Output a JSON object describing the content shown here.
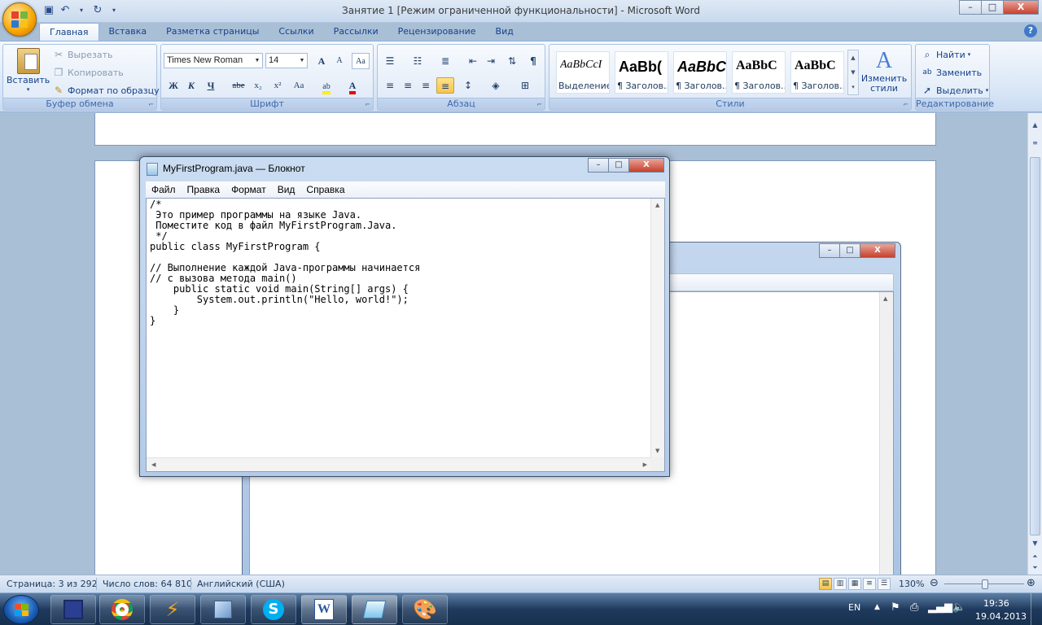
{
  "window": {
    "title": "Занятие 1 [Режим ограниченной функциональности]  -  Microsoft Word",
    "minimize": "–",
    "maximize": "□",
    "close": "X"
  },
  "ribbon_tabs": [
    "Главная",
    "Вставка",
    "Разметка страницы",
    "Ссылки",
    "Рассылки",
    "Рецензирование",
    "Вид"
  ],
  "clipboard": {
    "paste": "Вставить",
    "cut": "Вырезать",
    "copy": "Копировать",
    "format_painter": "Формат по образцу",
    "label": "Буфер обмена"
  },
  "font": {
    "family": "Times New Roman",
    "size": "14",
    "label": "Шрифт",
    "bold": "Ж",
    "italic": "К",
    "underline": "Ч",
    "strike": "abe",
    "subscript": "x₂",
    "superscript": "x²",
    "case": "Aa",
    "grow": "A",
    "shrink": "A"
  },
  "paragraph": {
    "label": "Абзац"
  },
  "styles": {
    "label": "Стили",
    "items": [
      {
        "sample": "AaBbCcI",
        "name": "Выделение"
      },
      {
        "sample": "AaBb(",
        "name": "¶ Заголов..."
      },
      {
        "sample": "AaBbC",
        "name": "¶ Заголов..."
      },
      {
        "sample": "AaBbC",
        "name": "¶ Заголов..."
      },
      {
        "sample": "AaBbC",
        "name": "¶ Заголов..."
      }
    ],
    "change": "Изменить стили"
  },
  "editing": {
    "label": "Редактирование",
    "find": "Найти",
    "replace": "Заменить",
    "select": "Выделить"
  },
  "notepad": {
    "title": "MyFirstProgram.java — Блокнот",
    "menu": [
      "Файл",
      "Правка",
      "Формат",
      "Вид",
      "Справка"
    ],
    "code": "/*\n Это пример программы на языке Java.\n Поместите код в файл MyFirstProgram.Java.\n */\npublic class MyFirstProgram {\n\n// Выполнение каждой Java-программы начинается\n// с вызова метода main()\n    public static void main(String[] args) {\n        System.out.println(\"Hello, world!\");\n    }\n}"
  },
  "status": {
    "page": "Страница: 3 из 292",
    "words": "Число слов: 64 810",
    "lang": "Английский (США)",
    "zoom": "130%"
  },
  "tray": {
    "lang": "EN",
    "time": "19:36",
    "date": "19.04.2013"
  }
}
